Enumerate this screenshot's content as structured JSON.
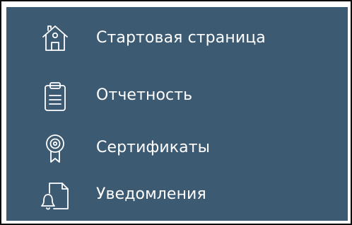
{
  "sidebar": {
    "background_color": "#3d5a73",
    "text_color": "#ffffff",
    "items": [
      {
        "label": "Стартовая страница",
        "icon": "home-icon"
      },
      {
        "label": "Отчетность",
        "icon": "clipboard-icon"
      },
      {
        "label": "Сертификаты",
        "icon": "certificate-badge-icon"
      },
      {
        "label": "Уведомления",
        "icon": "bell-document-icon"
      }
    ]
  }
}
